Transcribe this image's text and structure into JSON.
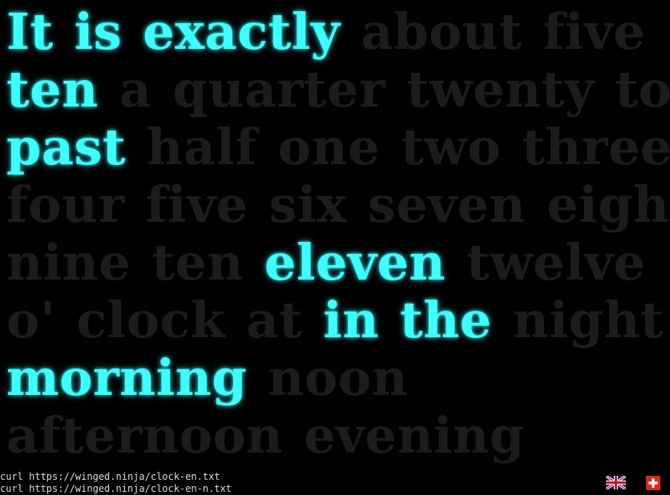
{
  "clock": {
    "lines": [
      [
        {
          "text": "It is exactly",
          "active": true
        },
        {
          "text": "about",
          "active": false
        },
        {
          "text": "five",
          "active": false
        }
      ],
      [
        {
          "text": "ten",
          "active": true
        },
        {
          "text": "a quarter",
          "active": false
        },
        {
          "text": "twenty",
          "active": false
        },
        {
          "text": "to",
          "active": false
        }
      ],
      [
        {
          "text": "past",
          "active": true
        },
        {
          "text": "half",
          "active": false
        },
        {
          "text": "one",
          "active": false
        },
        {
          "text": "two",
          "active": false
        },
        {
          "text": "three",
          "active": false
        }
      ],
      [
        {
          "text": "four",
          "active": false
        },
        {
          "text": "five",
          "active": false
        },
        {
          "text": "six",
          "active": false
        },
        {
          "text": "seven",
          "active": false
        },
        {
          "text": "eight",
          "active": false
        }
      ],
      [
        {
          "text": "nine",
          "active": false
        },
        {
          "text": "ten",
          "active": false
        },
        {
          "text": "eleven",
          "active": true
        },
        {
          "text": "twelve",
          "active": false
        }
      ],
      [
        {
          "text": "o' clock",
          "active": false
        },
        {
          "text": "at",
          "active": false
        },
        {
          "text": "in the",
          "active": true
        },
        {
          "text": "night",
          "active": false
        }
      ],
      [
        {
          "text": "morning",
          "active": true
        },
        {
          "text": "noon",
          "active": false
        }
      ],
      [
        {
          "text": "afternoon",
          "active": false
        },
        {
          "text": "evening",
          "active": false
        }
      ]
    ]
  },
  "footer": {
    "commands": [
      "curl https://winged.ninja/clock-en.txt",
      "curl https://winged.ninja/clock-en-n.txt"
    ]
  },
  "languages": [
    {
      "icon": "uk-flag-icon",
      "code": "en"
    },
    {
      "icon": "swiss-flag-icon",
      "code": "ch"
    }
  ],
  "colors": {
    "background": "#000000",
    "active_word": "#3ffcff",
    "inactive_word": "#1c1c1c",
    "command_text": "#dcdcdc"
  }
}
